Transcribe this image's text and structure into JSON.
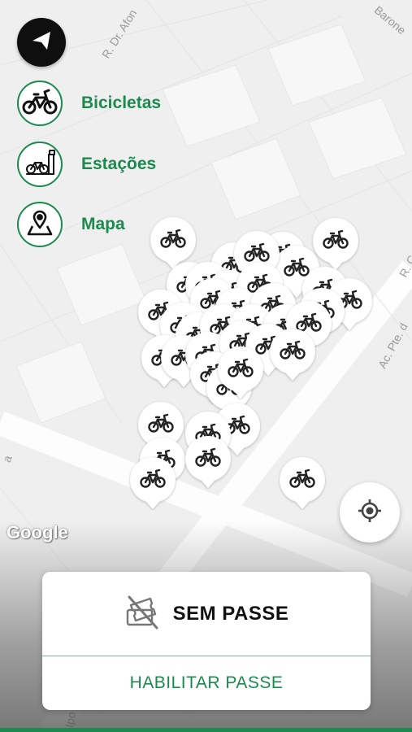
{
  "map": {
    "street_labels": [
      "R. Dr. Afon",
      "Barone",
      "R. C",
      "Ac. Pte. d",
      "a",
      "Ipo"
    ],
    "attribution": "Google",
    "pin_icon": "bicycle-icon",
    "pin_count": 40
  },
  "nav": {
    "back_icon": "navigation-arrow-icon"
  },
  "filters": [
    {
      "label": "Bicicletas",
      "icon": "bicycle-icon"
    },
    {
      "label": "Estações",
      "icon": "station-icon"
    },
    {
      "label": "Mapa",
      "icon": "map-pin-icon"
    }
  ],
  "locate": {
    "icon": "locate-crosshair-icon"
  },
  "pass_card": {
    "status_icon": "no-ticket-icon",
    "status": "SEM PASSE",
    "action": "HABILITAR PASSE"
  },
  "colors": {
    "accent": "#1b8a4f",
    "dark": "#0f0f0f",
    "map_bg": "#efefef"
  }
}
